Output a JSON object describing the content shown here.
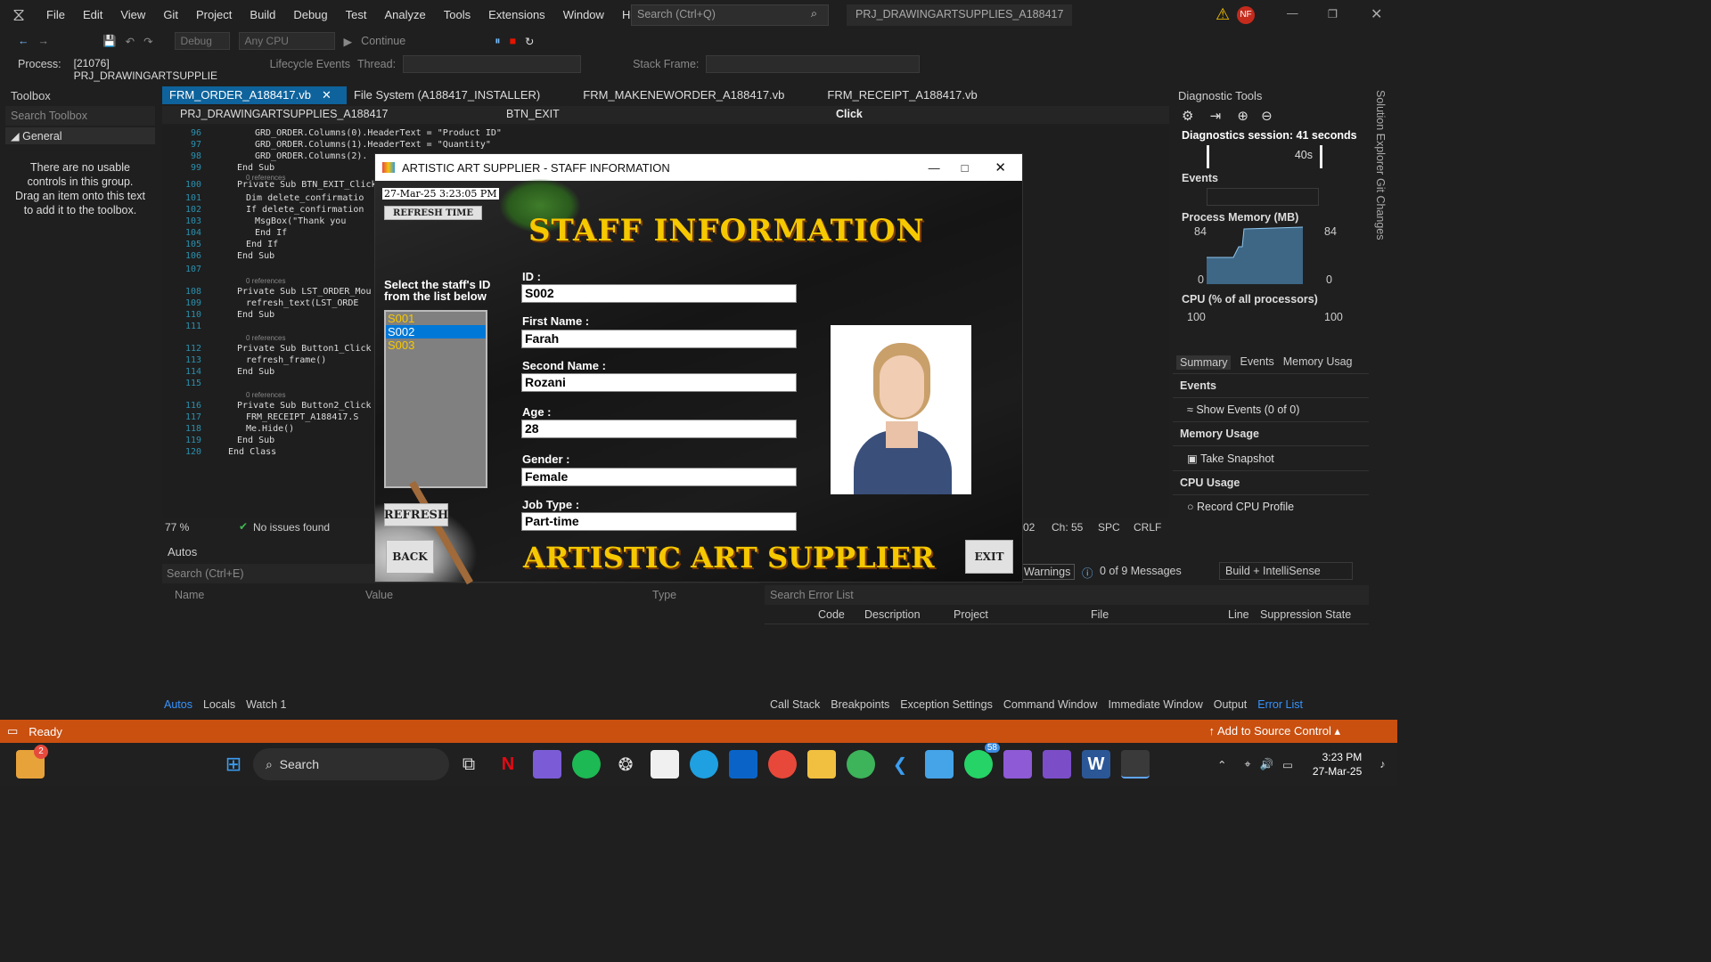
{
  "menubar": {
    "items": [
      "File",
      "Edit",
      "View",
      "Git",
      "Project",
      "Build",
      "Debug",
      "Test",
      "Analyze",
      "Tools",
      "Extensions",
      "Window",
      "Help"
    ],
    "search_placeholder": "Search (Ctrl+Q)",
    "project_name": "PRJ_DRAWINGARTSUPPLIES_A188417",
    "avatar": "NF"
  },
  "toolbar": {
    "config": "Debug",
    "platform": "Any CPU",
    "continue_label": "Continue",
    "process_label": "Process:",
    "process_value": "[21076] PRJ_DRAWINGARTSUPPLIE",
    "lifecycle": "Lifecycle Events",
    "thread_label": "Thread:",
    "stack_label": "Stack Frame:"
  },
  "toolbox": {
    "title": "Toolbox",
    "search_placeholder": "Search Toolbox",
    "group": "General",
    "empty_text": "There are no usable controls in this group. Drag an item onto this text to add it to the toolbox."
  },
  "tabs": [
    "FRM_ORDER_A188417.vb",
    "File System (A188417_INSTALLER)",
    "FRM_MAKENEWORDER_A188417.vb",
    "FRM_RECEIPT_A188417.vb"
  ],
  "editorbar": {
    "project": "PRJ_DRAWINGARTSUPPLIES_A188417",
    "object": "BTN_EXIT",
    "event": "Click"
  },
  "code": [
    {
      "n": "96",
      "t": "GRD_ORDER.Columns(0).HeaderText = \"Product ID\""
    },
    {
      "n": "97",
      "t": "GRD_ORDER.Columns(1).HeaderText = \"Quantity\""
    },
    {
      "n": "98",
      "t": "GRD_ORDER.Columns(2)."
    },
    {
      "n": "99",
      "t": "End Sub"
    },
    {
      "n": "100",
      "t": "Private Sub BTN_EXIT_Click"
    },
    {
      "n": "101",
      "t": "Dim delete_confirmatio"
    },
    {
      "n": "102",
      "t": "If delete_confirmation"
    },
    {
      "n": "103",
      "t": "MsgBox(\"Thank you"
    },
    {
      "n": "104",
      "t": "End If"
    },
    {
      "n": "105",
      "t": "End If"
    },
    {
      "n": "106",
      "t": "End Sub"
    },
    {
      "n": "107",
      "t": ""
    },
    {
      "n": "108",
      "t": "Private Sub LST_ORDER_Mou"
    },
    {
      "n": "109",
      "t": "refresh_text(LST_ORDE"
    },
    {
      "n": "110",
      "t": "End Sub"
    },
    {
      "n": "111",
      "t": ""
    },
    {
      "n": "112",
      "t": "Private Sub Button1_Click"
    },
    {
      "n": "113",
      "t": "refresh_frame()"
    },
    {
      "n": "114",
      "t": "End Sub"
    },
    {
      "n": "115",
      "t": ""
    },
    {
      "n": "116",
      "t": "Private Sub Button2_Click"
    },
    {
      "n": "117",
      "t": "FRM_RECEIPT_A188417.S"
    },
    {
      "n": "118",
      "t": "Me.Hide()"
    },
    {
      "n": "119",
      "t": "End Sub"
    },
    {
      "n": "120",
      "t": "End Class"
    }
  ],
  "references": "0 references",
  "editor_status": {
    "zoom": "77 %",
    "issues": "No issues found",
    "ln": "02",
    "ch": "Ch: 55",
    "spc": "SPC",
    "crlf": "CRLF"
  },
  "diagnostics": {
    "title": "Diagnostic Tools",
    "session": "Diagnostics session: 41 seconds",
    "timeline": "40s",
    "events": "Events",
    "memory_title": "Process Memory (MB)",
    "mem_max": "84",
    "mem_min": "0",
    "cpu_title": "CPU (% of all processors)",
    "cpu_max": "100",
    "tabs": [
      "Summary",
      "Events",
      "Memory Usag"
    ],
    "sections": [
      {
        "head": "Events",
        "action": "Show Events (0 of 0)"
      },
      {
        "head": "Memory Usage",
        "action": "Take Snapshot"
      },
      {
        "head": "CPU Usage",
        "action": "Record CPU Profile"
      }
    ]
  },
  "side_tabs": [
    "Solution Explorer",
    "Git Changes"
  ],
  "autos": {
    "title": "Autos",
    "search_placeholder": "Search (Ctrl+E)",
    "cols": [
      "Name",
      "Value",
      "Type"
    ],
    "tabs": [
      "Autos",
      "Locals",
      "Watch 1"
    ]
  },
  "errorlist": {
    "warnings": "Warnings",
    "messages": "0 of 9 Messages",
    "filter": "Build + IntelliSense",
    "search_placeholder": "Search Error List",
    "cols": [
      "Code",
      "Description",
      "Project",
      "File",
      "Line",
      "Suppression State"
    ],
    "tabs": [
      "Call Stack",
      "Breakpoints",
      "Exception Settings",
      "Command Window",
      "Immediate Window",
      "Output",
      "Error List"
    ]
  },
  "statusbar": {
    "ready": "Ready",
    "source_control": "Add to Source Control"
  },
  "taskbar": {
    "search": "Search",
    "time": "3:23 PM",
    "date": "27-Mar-25",
    "badge_left": "2",
    "badge_whatsapp": "58"
  },
  "app": {
    "title": "ARTISTIC ART SUPPLIER - STAFF INFORMATION",
    "datetime": "27-Mar-25 3:23:05 PM",
    "refresh_time": "REFRESH TIME",
    "heading": "STAFF INFORMATION",
    "select_label": "Select the staff's ID from the list below",
    "staff_ids": [
      "S001",
      "S002",
      "S003"
    ],
    "selected_id": "S002",
    "refresh": "REFRESH",
    "back": "BACK",
    "exit": "EXIT",
    "footer": "ARTISTIC ART SUPPLIER",
    "fields": {
      "id_label": "ID :",
      "id": "S002",
      "first_label": "First Name :",
      "first": "Farah",
      "second_label": "Second Name :",
      "second": "Rozani",
      "age_label": "Age :",
      "age": "28",
      "gender_label": "Gender :",
      "gender": "Female",
      "job_label": "Job Type :",
      "job": "Part-time"
    }
  }
}
